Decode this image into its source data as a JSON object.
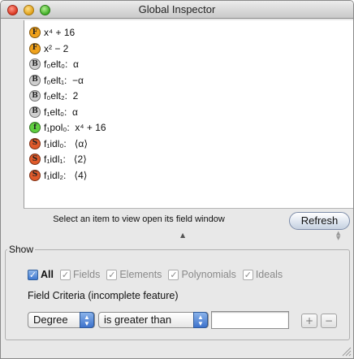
{
  "window": {
    "title": "Global Inspector"
  },
  "items": [
    {
      "badge": "F",
      "label": "x⁴ + 16",
      "color": "#f0a21c"
    },
    {
      "badge": "F",
      "label": "x² − 2",
      "color": "#f0a21c"
    },
    {
      "badge": "B",
      "label": "f₀elt₀:  α",
      "color": "#cfcfcf"
    },
    {
      "badge": "B",
      "label": "f₀elt₁:  −α",
      "color": "#cfcfcf"
    },
    {
      "badge": "B",
      "label": "f₀elt₂:  2",
      "color": "#cfcfcf"
    },
    {
      "badge": "B",
      "label": "f₁elt₀:  α",
      "color": "#cfcfcf"
    },
    {
      "badge": "f",
      "label": "f₁pol₀:  x⁴ + 16",
      "color": "#5fcf3f"
    },
    {
      "badge": "S",
      "label": "f₁idl₀:   ⟨α⟩",
      "color": "#e05a2a"
    },
    {
      "badge": "S",
      "label": "f₁idl₁:   ⟨2⟩",
      "color": "#e05a2a"
    },
    {
      "badge": "S",
      "label": "f₁idl₂:   ⟨4⟩",
      "color": "#e05a2a"
    }
  ],
  "status": {
    "message": "Select an item to view open its field window",
    "refresh_label": "Refresh"
  },
  "show": {
    "title": "Show",
    "checkboxes": [
      {
        "label": "All",
        "checked": true
      },
      {
        "label": "Fields",
        "checked": true
      },
      {
        "label": "Elements",
        "checked": true
      },
      {
        "label": "Polynomials",
        "checked": true
      },
      {
        "label": "Ideals",
        "checked": true
      }
    ],
    "criteria_label": "Field Criteria (incomplete feature)",
    "criteria_field": "Degree",
    "criteria_operator": "is greater than",
    "criteria_value": "",
    "add_label": "+",
    "remove_label": "−"
  },
  "icons": {
    "checkmark": "✓",
    "popup_arrows": "updown-arrows-icon"
  },
  "colors": {
    "accent": "#3d72cc",
    "window_bg": "#e8e8e8"
  }
}
